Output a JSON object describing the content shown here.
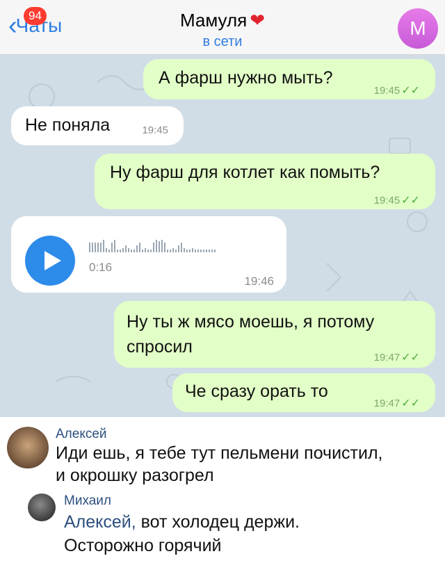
{
  "header": {
    "back_label": "Чаты",
    "badge_count": "94",
    "title": "Мамуля",
    "status": "в сети",
    "avatar_letter": "М"
  },
  "messages": [
    {
      "text": "А фарш нужно мыть?",
      "time": "19:45"
    },
    {
      "text": "Не поняла",
      "time": "19:45"
    },
    {
      "text": "Ну фарш для котлет как помыть?",
      "time": "19:45"
    },
    {
      "duration": "0:16",
      "time": "19:46"
    },
    {
      "line1": "Ну ты ж мясо моешь, я потому",
      "line2": "спросил",
      "time": "19:47"
    },
    {
      "text": "Че сразу орать то",
      "time": "19:47"
    }
  ],
  "comments": [
    {
      "author": "Алексей",
      "line1": "Иди ешь, я тебе тут пельмени почистил,",
      "line2": "и окрошку разогрел"
    },
    {
      "author": "Михаил",
      "mention": "Алексей,",
      "line1": " вот холодец держи.",
      "line2": "Осторожно горячий"
    }
  ],
  "colors": {
    "accent": "#2f7de1",
    "outgoing_bubble": "#e2ffc7",
    "incoming_bubble": "#ffffff",
    "chat_background": "#d1dde6",
    "badge": "#ff3b30"
  }
}
